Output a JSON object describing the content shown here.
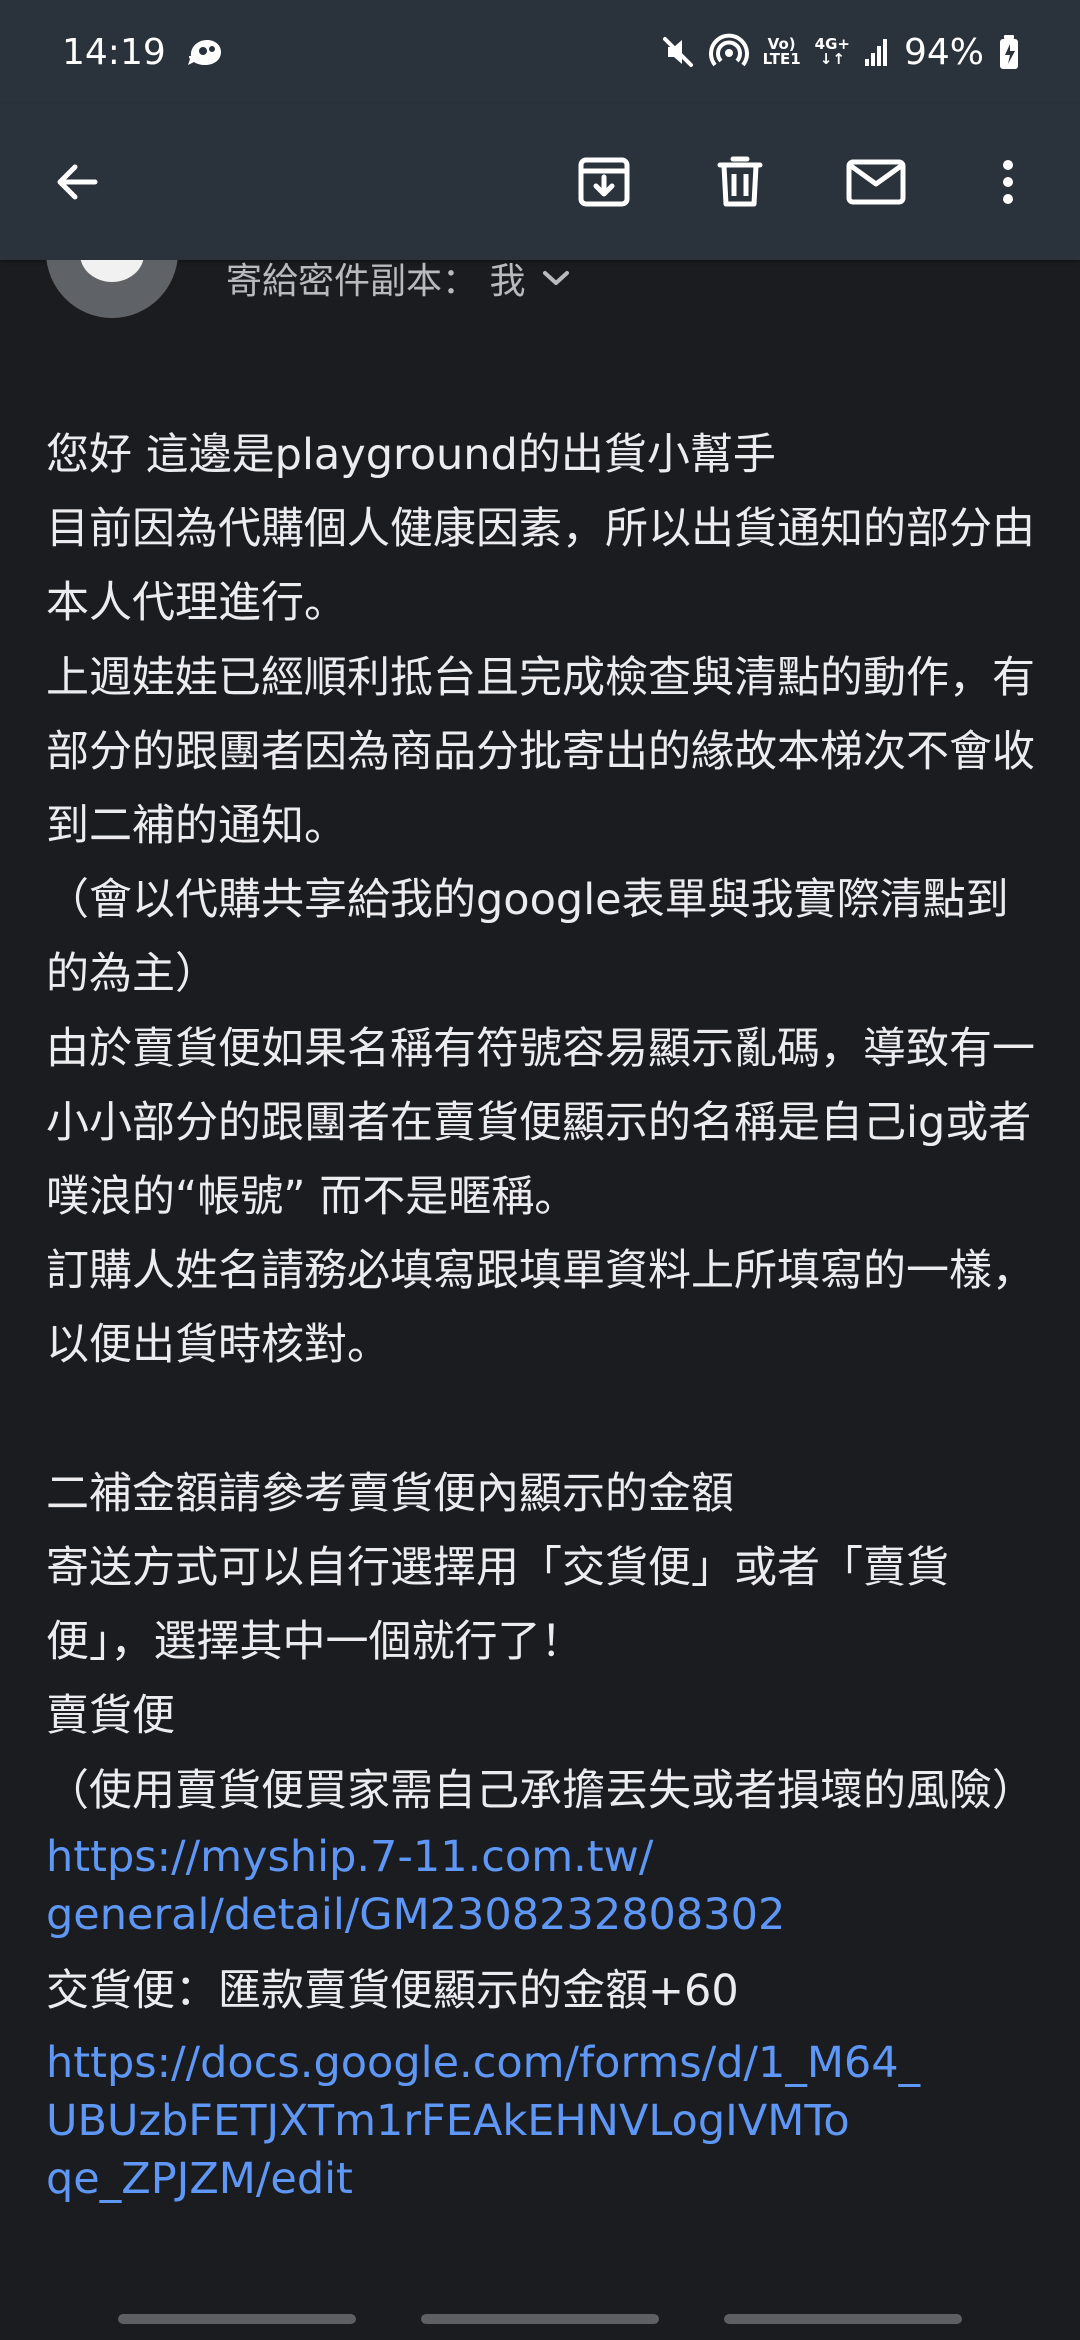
{
  "status_bar": {
    "time": "14:19",
    "battery": "94%",
    "network_top": "Vo)",
    "network_bottom": "LTE1",
    "data_type": "4G+",
    "icons": [
      "messenger-icon",
      "mute-icon",
      "hotspot-icon",
      "volte-icon",
      "data-icon",
      "signal-icon",
      "battery-icon"
    ]
  },
  "app_bar": {
    "icons": [
      "back-arrow-icon",
      "archive-icon",
      "delete-icon",
      "mark-unread-icon",
      "more-options-icon"
    ]
  },
  "sender": {
    "recipient_text": "寄給密件副本： 我"
  },
  "message": {
    "lines": [
      "您好 這邊是playground的出貨小幫手",
      "目前因為代購個人健康因素，所以出貨通知的部分由本人代理進行。",
      "上週娃娃已經順利抵台且完成檢查與清點的動作，有部分的跟團者因為商品分批寄出的緣故本梯次不會收到二補的通知。",
      "（會以代購共享給我的google表單與我實際清點到的為主）",
      "由於賣貨便如果名稱有符號容易顯示亂碼，導致有一小小部分的跟團者在賣貨便顯示的名稱是自己ig或者噗浪的“帳號” 而不是暱稱。",
      "訂購人姓名請務必填寫跟填單資料上所填寫的一樣，以便出貨時核對。"
    ],
    "lines2": [
      "二補金額請參考賣貨便內顯示的金額",
      "寄送方式可以自行選擇用「交貨便」或者「賣貨便」，選擇其中一個就行了！",
      "賣貨便",
      "（使用賣貨便買家需自己承擔丟失或者損壞的風險）"
    ],
    "link1": "https://myship.7-11.com.tw/\ngeneral/detail/GM2308232808302",
    "link1_line1": "https://myship.7-11.com.tw/",
    "link1_line2": "general/detail/GM2308232808302",
    "delivery_line": "交貨便：匯款賣貨便顯示的金額+60",
    "link2_line1": "https://docs.google.com/forms/d/1_M64_",
    "link2_line2": "UBUzbFETJXTm1rFEAkEHNVLogIVMTo",
    "link2_line3": "qe_ZPJZM/edit"
  },
  "colors": {
    "background": "#1b1c1f",
    "app_bar": "#2a323b",
    "text": "#ececee",
    "link": "#5e97f6"
  }
}
